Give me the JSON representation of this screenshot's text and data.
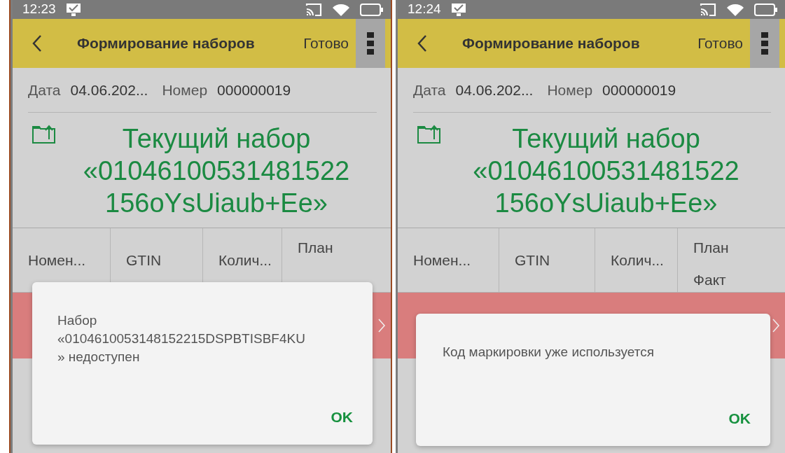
{
  "screens": [
    {
      "status_bar": {
        "time": "12:23"
      },
      "header": {
        "title": "Формирование наборов",
        "done": "Готово"
      },
      "fields": [
        {
          "label": "Дата",
          "value": "04.06.202..."
        },
        {
          "label": "Номер",
          "value": "000000019"
        }
      ],
      "current_set": {
        "lines": [
          "Текущий набор",
          "«01046100531481522",
          "156oYsUiaub+Ee»"
        ]
      },
      "table": {
        "columns": [
          {
            "lines": [
              "Номен..."
            ]
          },
          {
            "lines": [
              "GTIN"
            ]
          },
          {
            "lines": [
              "Колич..."
            ]
          },
          {
            "lines": [
              "План"
            ]
          }
        ],
        "rows": [
          {
            "highlighted": true
          }
        ]
      },
      "dialog": {
        "lines": [
          "Набор",
          "«0104610053148152215DSPBTISBF4KU",
          "» недоступен"
        ],
        "button": "OK"
      }
    },
    {
      "status_bar": {
        "time": "12:24"
      },
      "header": {
        "title": "Формирование наборов",
        "done": "Готово"
      },
      "fields": [
        {
          "label": "Дата",
          "value": "04.06.202..."
        },
        {
          "label": "Номер",
          "value": "000000019"
        }
      ],
      "current_set": {
        "lines": [
          "Текущий набор",
          "«01046100531481522",
          "156oYsUiaub+Ee»"
        ]
      },
      "table": {
        "columns": [
          {
            "lines": [
              "Номен..."
            ]
          },
          {
            "lines": [
              "GTIN"
            ]
          },
          {
            "lines": [
              "Колич..."
            ]
          },
          {
            "lines": [
              "План",
              "Факт"
            ]
          }
        ],
        "rows": [
          {
            "highlighted": true
          }
        ]
      },
      "dialog": {
        "lines": [
          "Код маркировки уже используется"
        ],
        "button": "OK"
      }
    }
  ]
}
